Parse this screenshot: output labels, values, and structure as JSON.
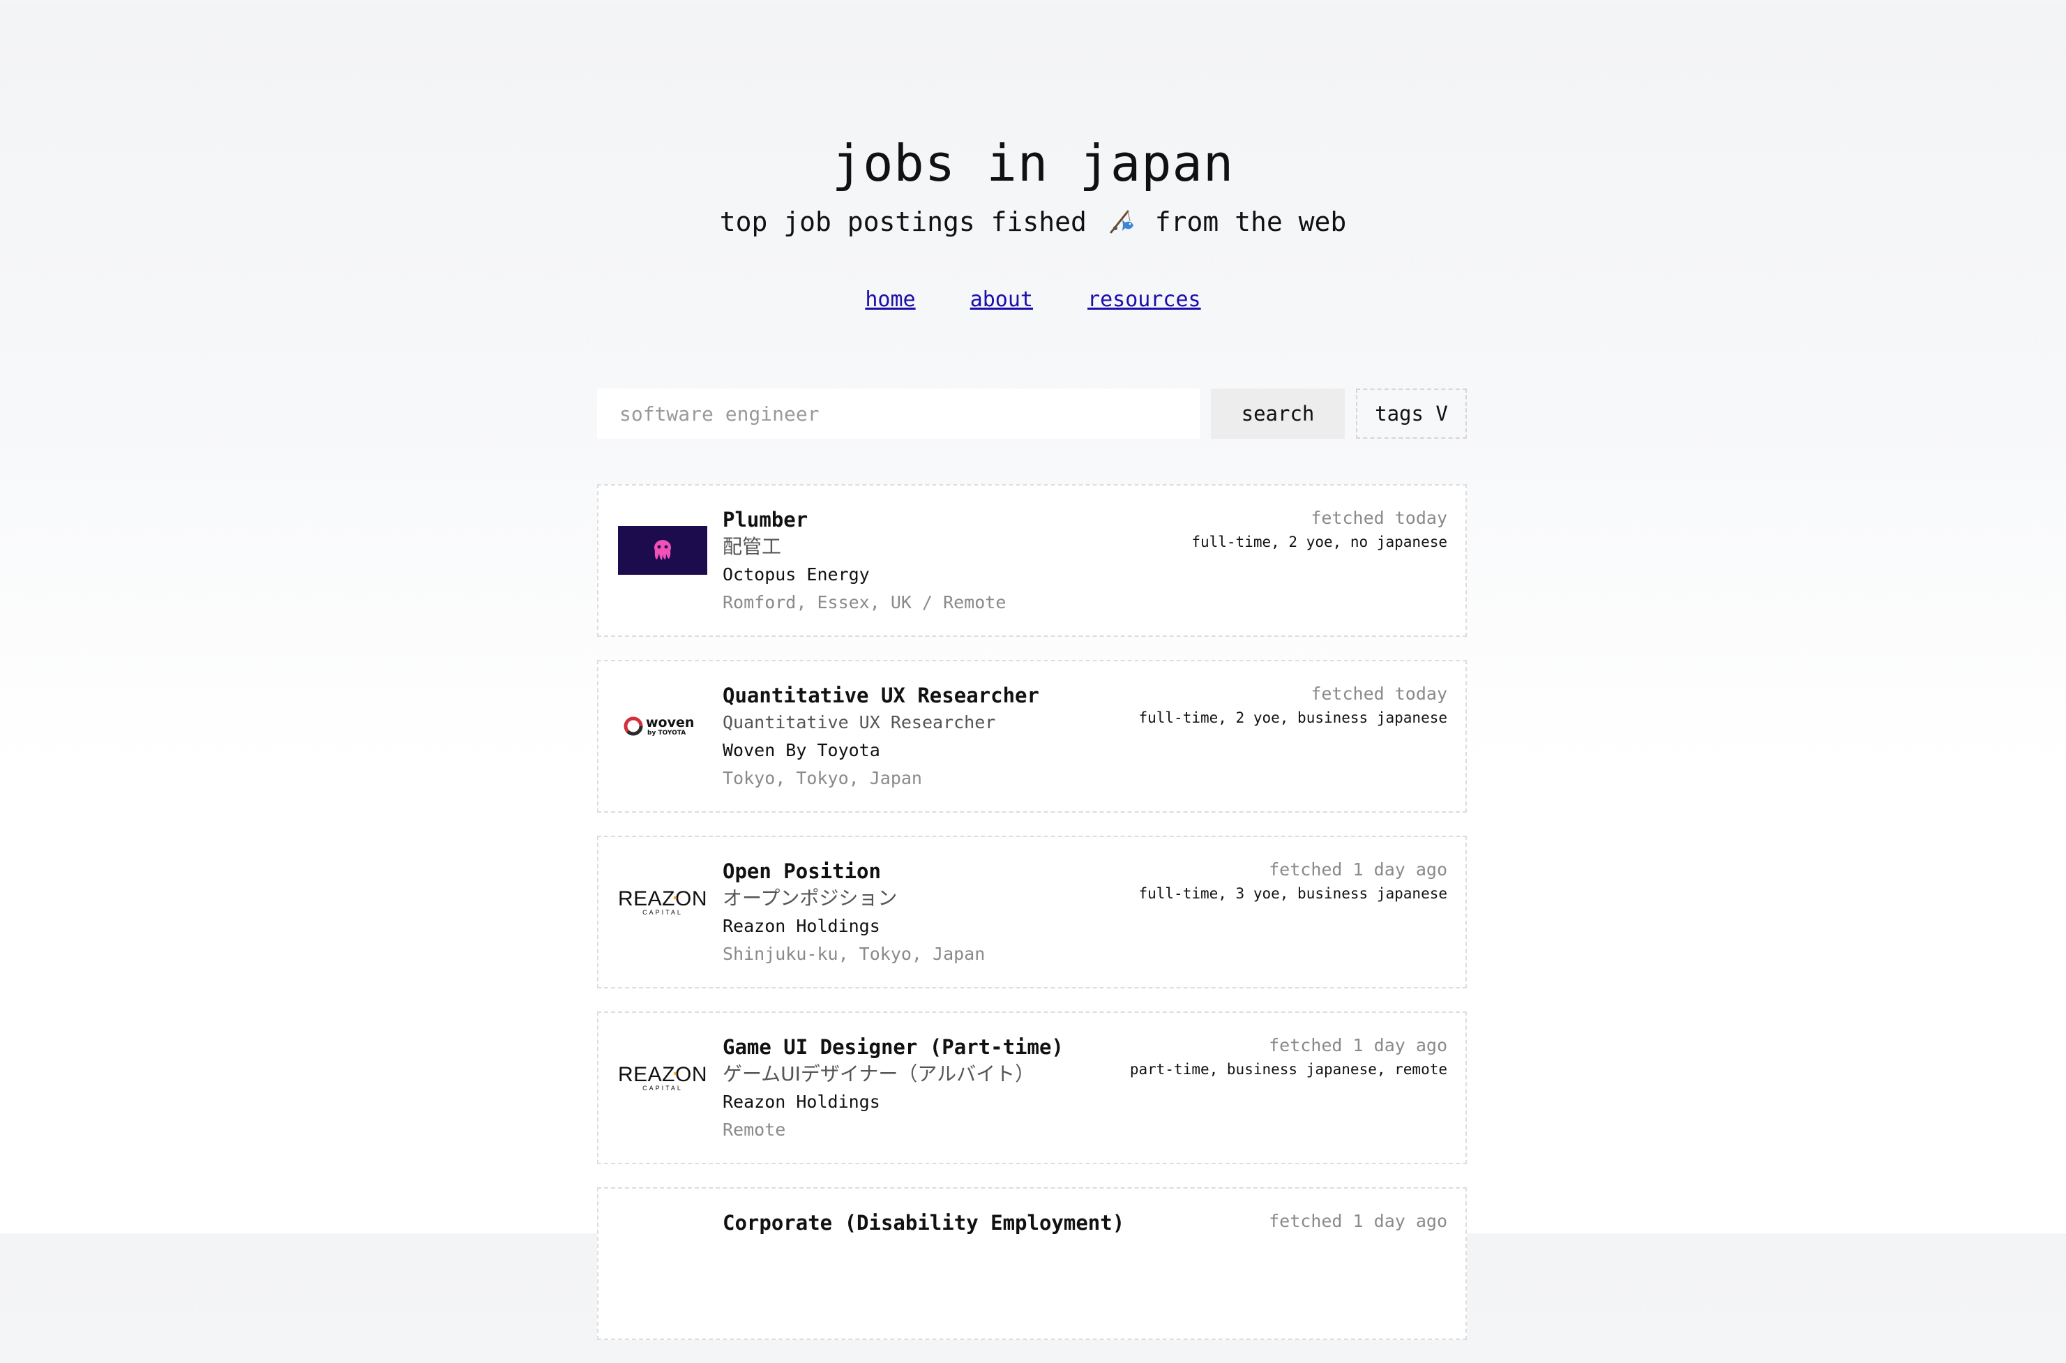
{
  "site": {
    "title": "jobs in japan",
    "tagline_before": "top job postings fished",
    "tagline_after": "from the web",
    "tagline_icon": "fishing-pole-icon"
  },
  "nav": {
    "items": [
      {
        "label": "home"
      },
      {
        "label": "about"
      },
      {
        "label": "resources"
      }
    ]
  },
  "search": {
    "placeholder": "software engineer",
    "value": "",
    "button_label": "search",
    "tags_label": "tags V"
  },
  "colors": {
    "link": "#1a0dab",
    "octopus_logo_bg": "#1c0b4d",
    "octopus_pink": "#f050b8"
  },
  "jobs": [
    {
      "title": "Plumber",
      "subtitle": "配管工",
      "company": "Octopus Energy",
      "location": "Romford, Essex, UK / Remote",
      "fetched": "fetched today",
      "tags": "full-time, 2 yoe, no japanese",
      "logo": "octopus-energy-logo"
    },
    {
      "title": "Quantitative UX Researcher",
      "subtitle": "Quantitative UX Researcher",
      "company": "Woven By Toyota",
      "location": "Tokyo, Tokyo, Japan",
      "fetched": "fetched today",
      "tags": "full-time, 2 yoe, business japanese",
      "logo": "woven-by-toyota-logo",
      "logo_text": "woven",
      "logo_subtext": "by TOYOTA"
    },
    {
      "title": "Open Position",
      "subtitle": "オープンポジション",
      "company": "Reazon Holdings",
      "location": "Shinjuku-ku, Tokyo, Japan",
      "fetched": "fetched 1 day ago",
      "tags": "full-time, 3 yoe, business japanese",
      "logo": "reazon-capital-logo",
      "logo_text": "REAZON",
      "logo_subtext": "CAPITAL"
    },
    {
      "title": "Game UI Designer (Part-time)",
      "subtitle": "ゲームUIデザイナー（アルバイト）",
      "company": "Reazon Holdings",
      "location": "Remote",
      "fetched": "fetched 1 day ago",
      "tags": "part-time, business japanese, remote",
      "logo": "reazon-capital-logo",
      "logo_text": "REAZON",
      "logo_subtext": "CAPITAL"
    },
    {
      "title": "Corporate (Disability Employment)",
      "fetched": "fetched 1 day ago"
    }
  ]
}
